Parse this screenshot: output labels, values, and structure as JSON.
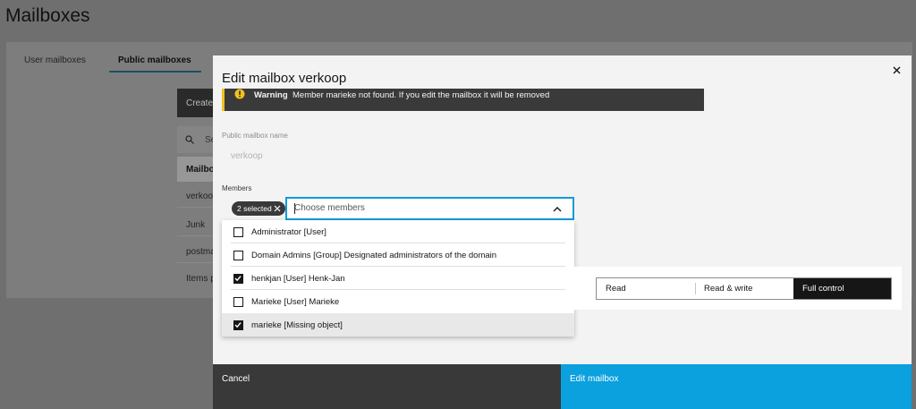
{
  "background": {
    "page_title": "Mailboxes",
    "tabs": [
      {
        "label": "User mailboxes"
      },
      {
        "label": "Public mailboxes"
      }
    ],
    "create_label": "Create",
    "search_label": "Se",
    "table_header": "Mailbox",
    "rows": [
      "verkoop",
      "Junk",
      "postmaster",
      "Items p"
    ]
  },
  "modal": {
    "title": "Edit mailbox verkoop",
    "warning": {
      "label": "Warning",
      "text": "Member marieke not found. If you edit the mailbox it will be removed"
    },
    "name_field": {
      "label": "Public mailbox name",
      "value": "verkoop"
    },
    "members": {
      "label": "Members",
      "selected_tag": "2 selected",
      "placeholder": "Choose members",
      "options": [
        {
          "label": "Administrator [User]",
          "checked": false
        },
        {
          "label": "Domain Admins [Group] Designated administrators of the domain",
          "checked": false
        },
        {
          "label": "henkjan [User] Henk-Jan",
          "checked": true
        },
        {
          "label": "Marieke [User] Marieke",
          "checked": false
        },
        {
          "label": "marieke [Missing object]",
          "checked": true
        }
      ]
    },
    "permissions": {
      "options": [
        "Read",
        "Read & write",
        "Full control"
      ],
      "selected": "Full control"
    },
    "footer": {
      "cancel_label": "Cancel",
      "submit_label": "Edit mailbox"
    }
  },
  "colors": {
    "accent": "#0ba0de",
    "focus_border": "#0f9ad8",
    "warning_icon": "#f1c21b",
    "dark": "#161616"
  },
  "icons": {
    "close": "close-icon",
    "warning": "warning-icon",
    "chevron": "chevron-up-icon",
    "tag_remove": "close-icon",
    "search": "search-icon"
  }
}
